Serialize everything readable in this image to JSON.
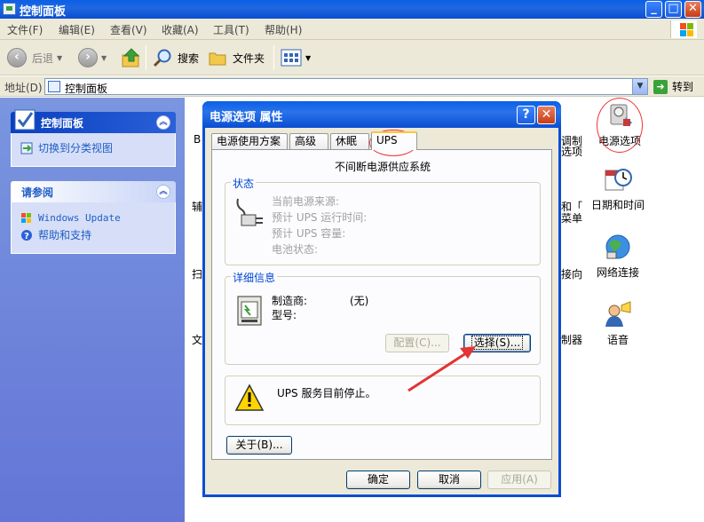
{
  "window": {
    "title": "控制面板",
    "controls": {
      "minimize": "_",
      "maximize": "□",
      "close": "✕"
    }
  },
  "menu": [
    "文件(F)",
    "编辑(E)",
    "查看(V)",
    "收藏(A)",
    "工具(T)",
    "帮助(H)"
  ],
  "toolbar": {
    "back": "后退",
    "search": "搜索",
    "folders": "文件夹"
  },
  "address": {
    "label": "地址(D)",
    "value": "控制面板",
    "go": "转到"
  },
  "leftpane": {
    "panel1": {
      "title": "控制面板",
      "items": [
        {
          "label": "切换到分类视图",
          "icon": "switch-view-icon"
        }
      ]
    },
    "panel2": {
      "title": "请参阅",
      "items": [
        {
          "label": "Windows Update",
          "icon": "windows-update-icon"
        },
        {
          "label": "帮助和支持",
          "icon": "help-icon"
        }
      ]
    }
  },
  "content": {
    "items": [
      {
        "label": "电源选项",
        "icon": "power-options-icon"
      },
      {
        "label": "日期和时间",
        "icon": "date-time-icon"
      },
      {
        "label": "网络连接",
        "icon": "network-icon"
      },
      {
        "label": "语音",
        "icon": "speech-icon"
      }
    ],
    "partial_left": [
      "B",
      "辅",
      "扫",
      "文"
    ],
    "partial_right": [
      "调制",
      "选项",
      "和「",
      "菜单",
      "接向",
      "制器"
    ]
  },
  "dialog": {
    "title": "电源选项 属性",
    "help": "?",
    "close": "✕",
    "tabs": [
      "电源使用方案",
      "高级",
      "休眠",
      "UPS"
    ],
    "active_tab": "UPS",
    "heading": "不间断电源供应系统",
    "status": {
      "title": "状态",
      "lines": [
        "当前电源来源:",
        "预计 UPS 运行时间:",
        "预计 UPS 容量:",
        "电池状态:"
      ]
    },
    "details": {
      "title": "详细信息",
      "manufacturer_label": "制造商:",
      "manufacturer_value": "(无)",
      "model_label": "型号:",
      "configure_button": "配置(C)...",
      "select_button": "选择(S)..."
    },
    "warning": "UPS 服务目前停止。",
    "about_button": "关于(B)...",
    "ok_button": "确定",
    "cancel_button": "取消",
    "apply_button": "应用(A)"
  },
  "colors": {
    "title_blue": "#0b4ed1",
    "annotation_red": "#e33333",
    "group_title_blue": "#0046d5"
  }
}
